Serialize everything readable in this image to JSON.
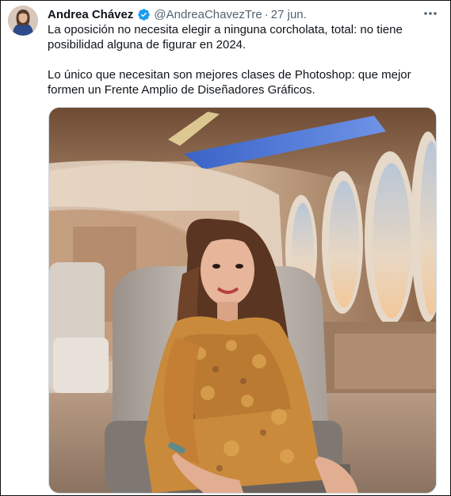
{
  "tweet": {
    "author_name": "Andrea Chávez",
    "author_handle": "@AndreaChavezTre",
    "separator": "·",
    "date": "27 jun.",
    "verified_icon": "verified-badge-icon",
    "more_icon": "more-options-icon",
    "paragraphs": [
      "La oposición no necesita elegir a ninguna corcholata, total: no tiene posibilidad alguna de figurar en 2024.",
      "Lo único que necesitan son mejores clases de Photoshop: que mejor formen un Frente Amplio de Diseñadores Gráficos."
    ]
  },
  "colors": {
    "text_primary": "#0f1419",
    "text_secondary": "#536471",
    "verified_blue": "#1d9bf0",
    "media_border": "#cfd9de"
  }
}
